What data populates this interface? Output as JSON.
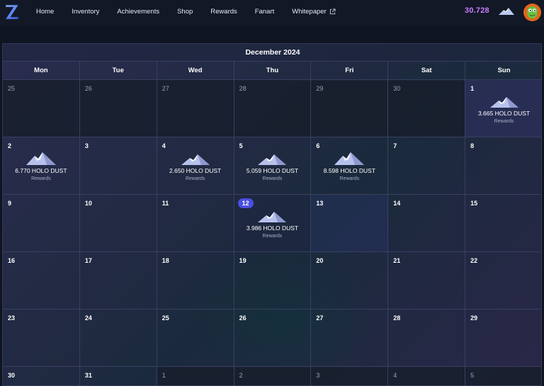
{
  "nav": {
    "links": [
      "Home",
      "Inventory",
      "Achievements",
      "Shop",
      "Rewards",
      "Fanart",
      "Whitepaper"
    ],
    "balance": "30.728",
    "logo_icon": "z-logo-icon",
    "external_icon": "external-link-icon"
  },
  "calendar": {
    "title": "December 2024",
    "weekdays": [
      "Mon",
      "Tue",
      "Wed",
      "Thu",
      "Fri",
      "Sat",
      "Sun"
    ],
    "reward_label": "Rewards",
    "days": [
      {
        "d": "25",
        "out": true
      },
      {
        "d": "26",
        "out": true
      },
      {
        "d": "27",
        "out": true
      },
      {
        "d": "28",
        "out": true
      },
      {
        "d": "29",
        "out": true
      },
      {
        "d": "30",
        "out": true
      },
      {
        "d": "1",
        "amount": "3.665 HOLO DUST",
        "style": "sunday1"
      },
      {
        "d": "2",
        "amount": "6.770 HOLO DUST",
        "big": true
      },
      {
        "d": "3"
      },
      {
        "d": "4",
        "amount": "2.650 HOLO DUST"
      },
      {
        "d": "5",
        "amount": "5.059 HOLO DUST"
      },
      {
        "d": "6",
        "amount": "8.598 HOLO DUST",
        "big": true
      },
      {
        "d": "7"
      },
      {
        "d": "8"
      },
      {
        "d": "9"
      },
      {
        "d": "10"
      },
      {
        "d": "11"
      },
      {
        "d": "12",
        "amount": "3.986 HOLO DUST",
        "today": true,
        "style": "today-cell"
      },
      {
        "d": "13",
        "style": "hl"
      },
      {
        "d": "14"
      },
      {
        "d": "15"
      },
      {
        "d": "16"
      },
      {
        "d": "17"
      },
      {
        "d": "18"
      },
      {
        "d": "19"
      },
      {
        "d": "20"
      },
      {
        "d": "21"
      },
      {
        "d": "22"
      },
      {
        "d": "23"
      },
      {
        "d": "24"
      },
      {
        "d": "25"
      },
      {
        "d": "26"
      },
      {
        "d": "27"
      },
      {
        "d": "28"
      },
      {
        "d": "29"
      },
      {
        "d": "30"
      },
      {
        "d": "31"
      },
      {
        "d": "1",
        "out": true
      },
      {
        "d": "2",
        "out": true
      },
      {
        "d": "3",
        "out": true
      },
      {
        "d": "4",
        "out": true
      },
      {
        "d": "5",
        "out": true
      }
    ]
  },
  "colors": {
    "accent": "#4a4ee0",
    "balance": "#c97bff"
  }
}
